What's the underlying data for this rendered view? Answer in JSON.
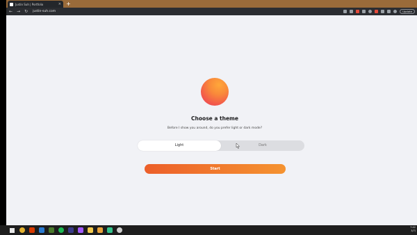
{
  "browser": {
    "tab_title": "Justin Suh | Portfolio",
    "url": "justin-suh.com",
    "update_label": "Update",
    "new_tab_symbol": "+",
    "close_tab_symbol": "×"
  },
  "page": {
    "title": "Choose a theme",
    "subtitle": "Before I show you around, do you prefer light or dark mode?",
    "theme_options": [
      "Light",
      "Dark"
    ],
    "selected_theme": "Light",
    "start_label": "Start",
    "accent_gradient": [
      "#ec5f2a",
      "#f59330"
    ]
  },
  "taskbar": {
    "apps": [
      "chrome-icon",
      "office-icon",
      "vscode-icon",
      "game-icon",
      "spotify-icon",
      "files-icon",
      "figma-icon",
      "note-icon",
      "sticky-icon",
      "maps-icon",
      "settings-icon"
    ],
    "clock": "7:42",
    "date": "3/7/"
  }
}
